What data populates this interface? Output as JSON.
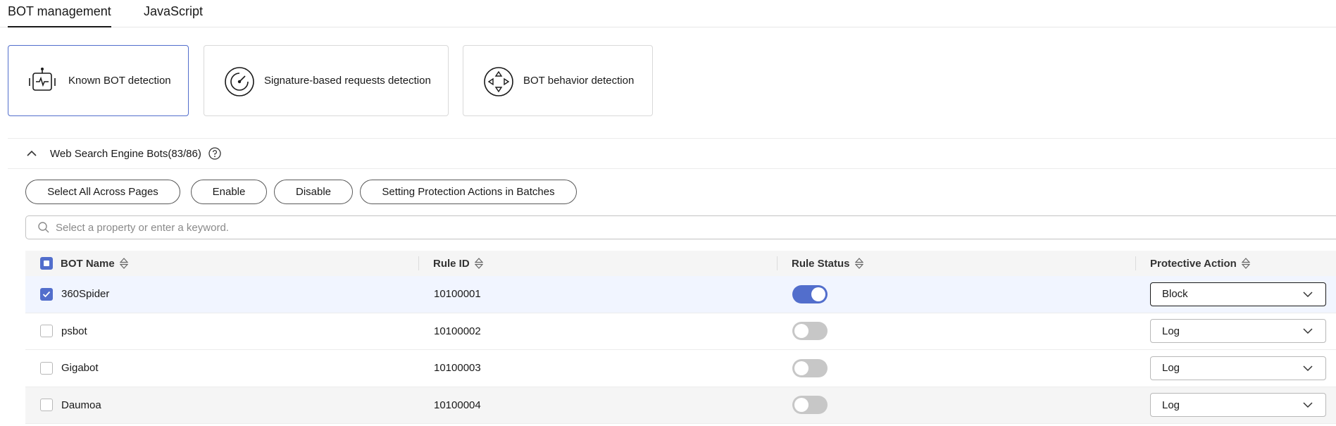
{
  "tabs": [
    {
      "label": "BOT management",
      "active": true
    },
    {
      "label": "JavaScript",
      "active": false
    }
  ],
  "cards": [
    {
      "label": "Known BOT detection",
      "icon": "robot-icon",
      "selected": true
    },
    {
      "label": "Signature-based requests detection",
      "icon": "target-icon",
      "selected": false
    },
    {
      "label": "BOT behavior detection",
      "icon": "direction-pad-icon",
      "selected": false
    }
  ],
  "section": {
    "title": "Web Search Engine Bots(83/86)",
    "expanded": true
  },
  "actions": {
    "select_all": "Select All Across Pages",
    "enable": "Enable",
    "disable": "Disable",
    "batch_actions": "Setting Protection Actions in Batches"
  },
  "search": {
    "placeholder": "Select a property or enter a keyword.",
    "value": ""
  },
  "table": {
    "columns": [
      "BOT Name",
      "Rule ID",
      "Rule Status",
      "Protective Action"
    ],
    "rows": [
      {
        "name": "360Spider",
        "rule_id": "10100001",
        "status_on": true,
        "action": "Block",
        "checked": true
      },
      {
        "name": "psbot",
        "rule_id": "10100002",
        "status_on": false,
        "action": "Log",
        "checked": false
      },
      {
        "name": "Gigabot",
        "rule_id": "10100003",
        "status_on": false,
        "action": "Log",
        "checked": false
      },
      {
        "name": "Daumoa",
        "rule_id": "10100004",
        "status_on": false,
        "action": "Log",
        "checked": false
      }
    ]
  },
  "colors": {
    "accent": "#526ecc",
    "toggle_off": "#c7c7c7",
    "selected_row": "#f1f5ff"
  }
}
